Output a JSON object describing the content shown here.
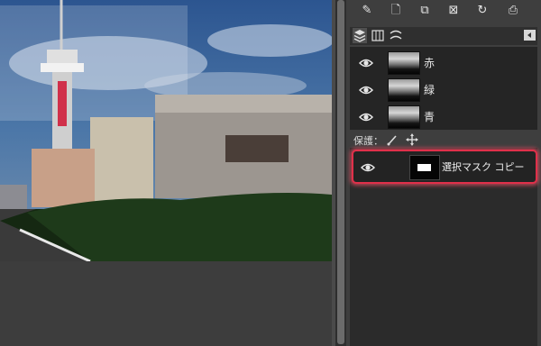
{
  "toolbar": {
    "icons": [
      "new-layer-icon",
      "new-document-icon",
      "duplicate-icon",
      "delete-icon",
      "refresh-icon",
      "save-icon"
    ]
  },
  "tabs": {
    "icons": [
      "layers-icon",
      "channels-icon",
      "paths-icon"
    ],
    "active": 0
  },
  "channels": [
    {
      "label": "赤",
      "visible": true
    },
    {
      "label": "緑",
      "visible": true
    },
    {
      "label": "青",
      "visible": true
    }
  ],
  "lock": {
    "label": "保護："
  },
  "mask_channel": {
    "label": "選択マスク コピー",
    "visible": true
  },
  "colors": {
    "highlight": "#e0304a",
    "panel_bg": "#3e3e3e"
  }
}
